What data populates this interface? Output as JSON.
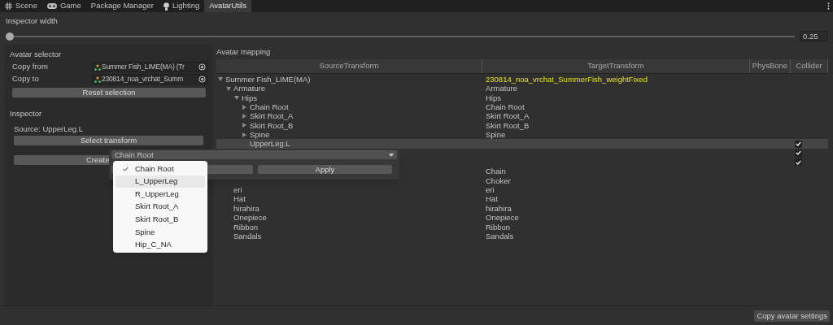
{
  "tabs": [
    {
      "label": "Scene",
      "kind": "scene",
      "selected": false
    },
    {
      "label": "Game",
      "kind": "game",
      "selected": false
    },
    {
      "label": "Package Manager",
      "kind": "plain",
      "selected": false
    },
    {
      "label": "Lighting",
      "kind": "lighting",
      "selected": false
    },
    {
      "label": "AvatarUtils",
      "kind": "plain",
      "selected": true
    }
  ],
  "inspector_width": {
    "label": "Inspector width",
    "level": 0,
    "value": "0.25"
  },
  "avatar_selector": {
    "title": "Avatar selector",
    "fields": [
      {
        "label": "Copy from",
        "value": "Summer Fish_LIME(MA) (Tr"
      },
      {
        "label": "Copy to",
        "value": "230814_noa_vrchat_Summ"
      }
    ],
    "reset_button": "Reset selection"
  },
  "inspector": {
    "title": "Inspector",
    "source": "Source: UpperLeg.L",
    "select_button": "Select transform",
    "create_button": "Create"
  },
  "mapping": {
    "title": "Avatar mapping",
    "columns": [
      "SourceTransform",
      "TargetTransform",
      "PhysBone",
      "Collider"
    ],
    "rows": [
      {
        "source": "Summer Fish_LIME(MA)",
        "target": "230814_noa_vrchat_SummerFish_weightFixed",
        "kind": "root",
        "expanded": true,
        "selected": false,
        "collider": false,
        "children": [
          {
            "source": "Armature",
            "target": "Armature",
            "expanded": true,
            "selected": false,
            "collider": false,
            "children": [
              {
                "source": "Hips",
                "target": "Hips",
                "expanded": true,
                "selected": false,
                "collider": false,
                "children": [
                  {
                    "source": "Chain Root",
                    "target": "Chain Root",
                    "expanded": false,
                    "selected": false,
                    "collider": false
                  },
                  {
                    "source": "Skirt Root_A",
                    "target": "Skirt Root_A",
                    "expanded": false,
                    "selected": false,
                    "collider": false
                  },
                  {
                    "source": "Skirt Root_B",
                    "target": "Skirt Root_B",
                    "expanded": false,
                    "selected": false,
                    "collider": false
                  },
                  {
                    "source": "Spine",
                    "target": "Spine",
                    "expanded": false,
                    "selected": false,
                    "collider": false
                  },
                  {
                    "source": "UpperLeg.L",
                    "selected": true,
                    "collider": true
                  }
                ]
              }
            ]
          },
          {
            "selected": false,
            "collider": true
          },
          {
            "selected": false,
            "collider": true
          },
          {
            "target": "Chain",
            "selected": false,
            "collider": false
          },
          {
            "target": "Choker",
            "selected": false,
            "collider": false
          },
          {
            "source": "eri",
            "target": "eri",
            "selected": false,
            "collider": false
          },
          {
            "source": "Hat",
            "target": "Hat",
            "selected": false,
            "collider": false
          },
          {
            "source": "hirahira",
            "target": "hirahira",
            "selected": false,
            "collider": false
          },
          {
            "source": "Onepiece",
            "target": "Onepiece",
            "selected": false,
            "collider": false
          },
          {
            "source": "Ribbon",
            "target": "Ribbon",
            "selected": false,
            "collider": false
          },
          {
            "source": "Sandals",
            "target": "Sandals",
            "selected": false,
            "collider": false
          }
        ]
      }
    ]
  },
  "popup": {
    "dropdown_value": "Chain Root",
    "apply_button": "Apply",
    "menu": [
      {
        "label": "Chain Root",
        "checked": true,
        "selected": false
      },
      {
        "label": "L_UpperLeg",
        "checked": false,
        "selected": true
      },
      {
        "label": "R_UpperLeg",
        "checked": false,
        "selected": false
      },
      {
        "label": "Skirt Root_A",
        "checked": false,
        "selected": false
      },
      {
        "label": "Skirt Root_B",
        "checked": false,
        "selected": false
      },
      {
        "label": "Spine",
        "checked": false,
        "selected": false
      },
      {
        "label": "Hip_C_NA",
        "checked": false,
        "selected": false
      }
    ]
  },
  "footer_button": "Copy avatar settings"
}
